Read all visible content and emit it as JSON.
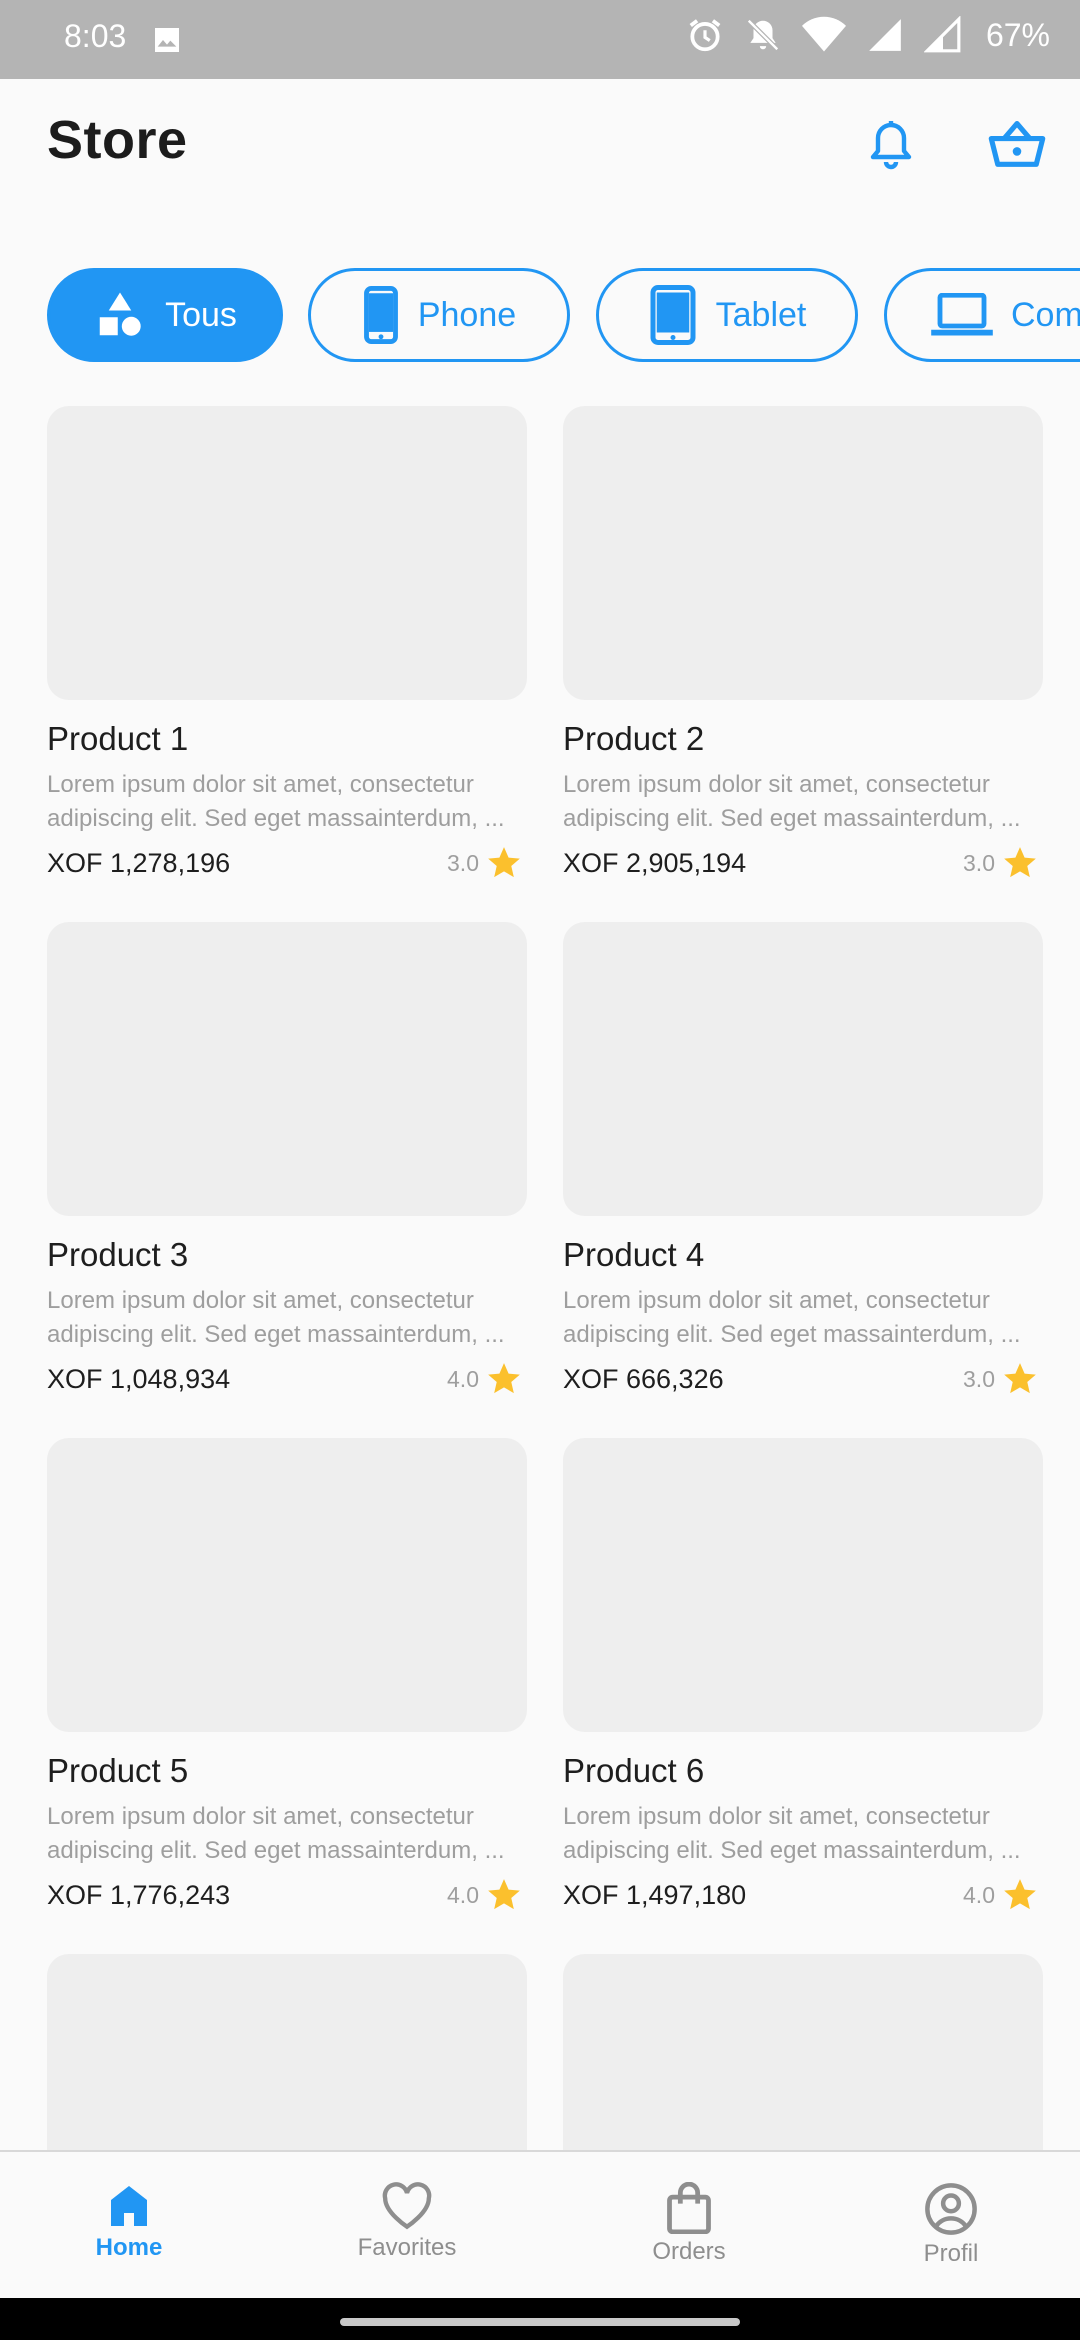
{
  "status_bar": {
    "time": "8:03",
    "battery": "67%"
  },
  "header": {
    "title": "Store"
  },
  "categories": [
    {
      "label": "Tous",
      "icon": "shapes-icon",
      "active": true
    },
    {
      "label": "Phone",
      "icon": "phone-icon",
      "active": false
    },
    {
      "label": "Tablet",
      "icon": "tablet-icon",
      "active": false
    },
    {
      "label": "Comp",
      "icon": "laptop-icon",
      "active": false
    }
  ],
  "products": [
    {
      "name": "Product 1",
      "desc_line1": "Lorem ipsum dolor sit amet, consectetur",
      "desc_line2": "adipiscing elit. Sed eget massainterdum, ...",
      "price": "XOF 1,278,196",
      "rating": "3.0"
    },
    {
      "name": "Product 2",
      "desc_line1": "Lorem ipsum dolor sit amet, consectetur",
      "desc_line2": "adipiscing elit. Sed eget massainterdum, ...",
      "price": "XOF 2,905,194",
      "rating": "3.0"
    },
    {
      "name": "Product 3",
      "desc_line1": "Lorem ipsum dolor sit amet, consectetur",
      "desc_line2": "adipiscing elit. Sed eget massainterdum, ...",
      "price": "XOF 1,048,934",
      "rating": "4.0"
    },
    {
      "name": "Product 4",
      "desc_line1": "Lorem ipsum dolor sit amet, consectetur",
      "desc_line2": "adipiscing elit. Sed eget massainterdum, ...",
      "price": "XOF 666,326",
      "rating": "3.0"
    },
    {
      "name": "Product 5",
      "desc_line1": "Lorem ipsum dolor sit amet, consectetur",
      "desc_line2": "adipiscing elit. Sed eget massainterdum, ...",
      "price": "XOF 1,776,243",
      "rating": "4.0"
    },
    {
      "name": "Product 6",
      "desc_line1": "Lorem ipsum dolor sit amet, consectetur",
      "desc_line2": "adipiscing elit. Sed eget massainterdum, ...",
      "price": "XOF 1,497,180",
      "rating": "4.0"
    }
  ],
  "bottom_nav": [
    {
      "label": "Home",
      "icon": "home-icon",
      "active": true
    },
    {
      "label": "Favorites",
      "icon": "heart-icon",
      "active": false
    },
    {
      "label": "Orders",
      "icon": "shopping-bag-icon",
      "active": false
    },
    {
      "label": "Profil",
      "icon": "account-circle-icon",
      "active": false
    }
  ],
  "colors": {
    "accent": "#2196f3",
    "star": "#fbc02d",
    "placeholder": "#eeeeee",
    "status_bar": "#b4b4b4"
  }
}
